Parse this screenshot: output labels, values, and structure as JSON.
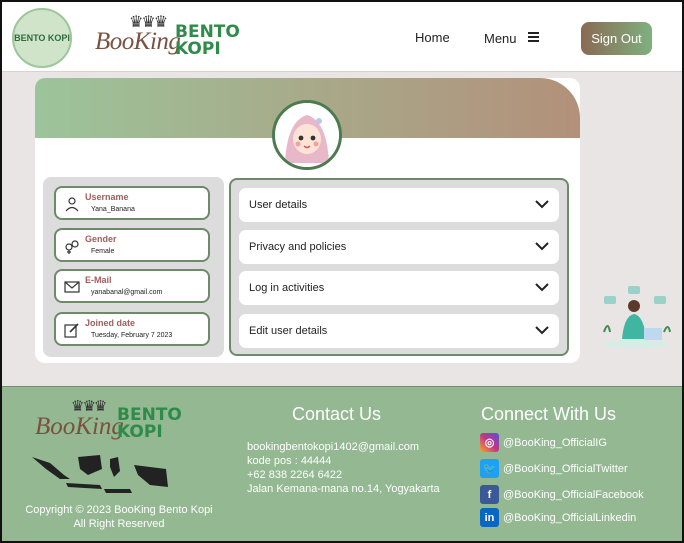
{
  "header": {
    "logo_badge_text": "BENTO KOPI",
    "brand_booking": "BooKing",
    "brand_bento": "BENTO",
    "brand_kopi": "KOPI",
    "nav_home": "Home",
    "nav_menu": "Menu",
    "sign_out": "Sign Out"
  },
  "profile": {
    "fields": [
      {
        "label": "Username",
        "value": "Yana_Banana",
        "icon": "user-icon"
      },
      {
        "label": "Gender",
        "value": "Female",
        "icon": "gender-icon"
      },
      {
        "label": "E-Mail",
        "value": "yanabanal@gmail.com",
        "icon": "mail-icon"
      },
      {
        "label": "Joined date",
        "value": "Tuesday, February 7 2023",
        "icon": "edit-icon"
      }
    ],
    "sections": [
      {
        "label": "User details"
      },
      {
        "label": "Privacy and policies"
      },
      {
        "label": "Log in activities"
      },
      {
        "label": "Edit user details"
      }
    ]
  },
  "footer": {
    "brand_booking": "BooKing",
    "brand_bento": "BENTO",
    "brand_kopi": "KOPI",
    "copyright_line1": "Copyright © 2023 BooKing Bento Kopi",
    "copyright_line2": "All Right Reserved",
    "contact_title": "Contact Us",
    "contact": [
      "bookingbentokopi1402@gmail.com",
      "kode pos : 44444",
      "+62 838 2264 6422",
      "Jalan Kemana-mana no.14, Yogyakarta"
    ],
    "connect_title": "Connect With Us",
    "socials": [
      {
        "label": "@BooKing_OfficialIG",
        "icon": "instagram-icon",
        "color": "#c13584"
      },
      {
        "label": "@BooKing_OfficialTwitter",
        "icon": "twitter-icon",
        "color": "#1da1f2"
      },
      {
        "label": "@BooKing_OfficialFacebook",
        "icon": "facebook-icon",
        "color": "#3b5998"
      },
      {
        "label": "@BooKing_OfficialLinkedin",
        "icon": "linkedin-icon",
        "color": "#0a66c2"
      }
    ]
  },
  "colors": {
    "accent_green": "#93b892",
    "accent_brown": "#8a6a52",
    "label_red": "#a35d5d"
  }
}
